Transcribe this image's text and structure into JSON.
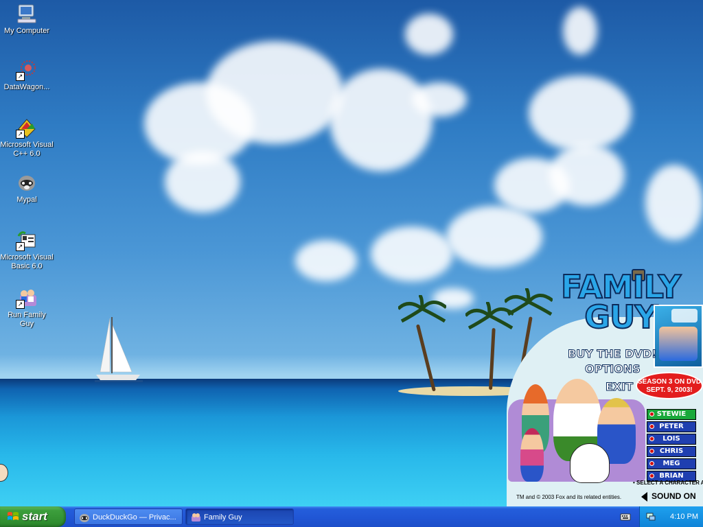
{
  "desktop": {
    "icons": [
      {
        "label": "My Computer",
        "icon": "computer-icon"
      },
      {
        "label": "DataWagon...",
        "icon": "datawagon-icon"
      },
      {
        "label": "Microsoft Visual C++ 6.0",
        "icon": "visual-cpp-icon"
      },
      {
        "label": "Mypal",
        "icon": "mypal-icon"
      },
      {
        "label": "Microsoft Visual Basic 6.0",
        "icon": "visual-basic-icon"
      },
      {
        "label": "Run Family Guy",
        "icon": "family-guy-icon"
      }
    ]
  },
  "launcher": {
    "title_line1": "FAMILY",
    "title_line2": "GUY",
    "menu": [
      "BUY THE DVD!",
      "OPTIONS",
      "EXIT"
    ],
    "season_badge": "SEASON 3 ON DVD SEPT. 9, 2003!",
    "characters": [
      "STEWIE",
      "PETER",
      "LOIS",
      "CHRIS",
      "MEG",
      "BRIAN"
    ],
    "selected_character": "STEWIE",
    "select_hint": "• SELECT A CHARACTER ABOVE",
    "copyright": "TM and © 2003 Fox and its related entities.",
    "sound": "SOUND ON"
  },
  "taskbar": {
    "start_label": "start",
    "tasks": [
      {
        "label": "DuckDuckGo — Privac...",
        "icon": "mypal-icon"
      },
      {
        "label": "Family Guy",
        "icon": "family-guy-icon",
        "active": true
      }
    ],
    "clock": "4:10 PM"
  },
  "colors": {
    "taskbar_blue": "#245edb",
    "start_green": "#3c9e3c",
    "tray_blue": "#0f84d8",
    "fg_title_blue": "#2aa6e8",
    "fg_badge_red": "#e31d1d"
  }
}
